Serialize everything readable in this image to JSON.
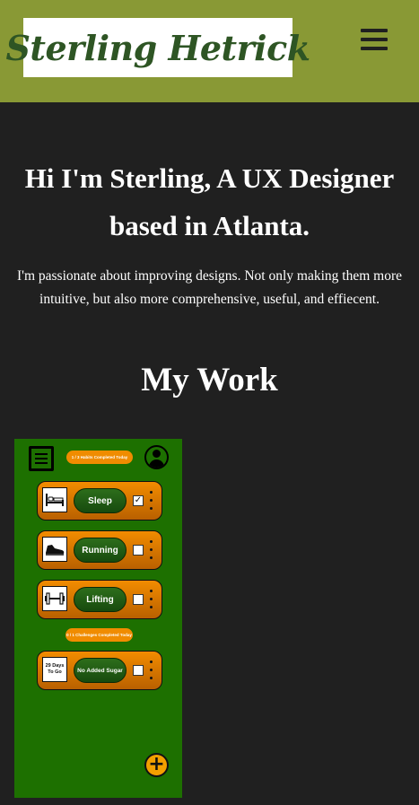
{
  "header": {
    "logo_text": "Sterling Hetrick",
    "menu_icon": "hamburger-menu-icon",
    "background_color": "#899935"
  },
  "hero": {
    "title": "Hi I'm Sterling, A UX Designer based in Atlanta.",
    "subtitle": "I'm passionate about improving designs. Not only making them more intuitive, but also more comprehensive, useful, and effiecent."
  },
  "work": {
    "section_title": "My Work",
    "project_card": {
      "habits_status": "1 / 3 Habits Completed Today",
      "challenges_status": "0 / 1 Challenges Completed Today",
      "habits": [
        {
          "label": "Sleep",
          "icon": "bed-icon",
          "checked": "✓"
        },
        {
          "label": "Running",
          "icon": "running-shoe-icon",
          "checked": ""
        },
        {
          "label": "Lifting",
          "icon": "dumbbell-icon",
          "checked": ""
        }
      ],
      "challenge": {
        "label": "No Added Sugar",
        "days_line1": "29 Days",
        "days_line2": "To Go",
        "checked": ""
      },
      "add_symbol": "+",
      "background_color": "#1d7000",
      "accent_color": "#f08c00"
    }
  }
}
